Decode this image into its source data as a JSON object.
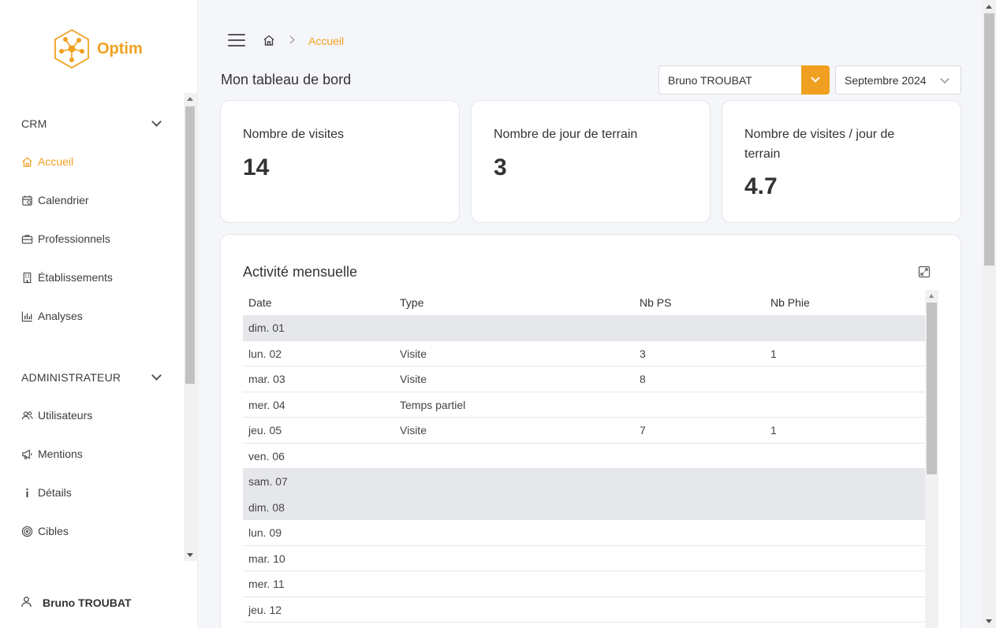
{
  "app": {
    "name": "Optim",
    "accent_color": "#f0a020"
  },
  "sidebar": {
    "sections": [
      {
        "title": "CRM",
        "items": [
          {
            "label": "Accueil",
            "icon": "home-icon",
            "active": true
          },
          {
            "label": "Calendrier",
            "icon": "calendar-icon"
          },
          {
            "label": "Professionnels",
            "icon": "briefcase-icon"
          },
          {
            "label": "Établissements",
            "icon": "building-icon"
          },
          {
            "label": "Analyses",
            "icon": "bar-chart-icon"
          }
        ]
      },
      {
        "title": "ADMINISTRATEUR",
        "items": [
          {
            "label": "Utilisateurs",
            "icon": "users-icon"
          },
          {
            "label": "Mentions",
            "icon": "megaphone-icon"
          },
          {
            "label": "Détails",
            "icon": "info-icon"
          },
          {
            "label": "Cibles",
            "icon": "target-icon"
          }
        ]
      }
    ],
    "user": "Bruno TROUBAT"
  },
  "breadcrumb": {
    "current": "Accueil"
  },
  "page": {
    "title": "Mon tableau de bord"
  },
  "filters": {
    "user": "Bruno TROUBAT",
    "month": "Septembre 2024"
  },
  "kpis": [
    {
      "label": "Nombre de visites",
      "value": "14"
    },
    {
      "label": "Nombre de jour de terrain",
      "value": "3"
    },
    {
      "label": "Nombre de visites / jour de terrain",
      "value": "4.7"
    }
  ],
  "activity": {
    "title": "Activité mensuelle",
    "columns": [
      "Date",
      "Type",
      "Nb PS",
      "Nb Phie"
    ],
    "rows": [
      {
        "date": "dim. 01",
        "type": "",
        "nb_ps": "",
        "nb_phie": "",
        "weekend": true
      },
      {
        "date": "lun. 02",
        "type": "Visite",
        "nb_ps": "3",
        "nb_phie": "1"
      },
      {
        "date": "mar. 03",
        "type": "Visite",
        "nb_ps": "8",
        "nb_phie": ""
      },
      {
        "date": "mer. 04",
        "type": "Temps partiel",
        "nb_ps": "",
        "nb_phie": ""
      },
      {
        "date": "jeu. 05",
        "type": "Visite",
        "nb_ps": "7",
        "nb_phie": "1"
      },
      {
        "date": "ven. 06",
        "type": "",
        "nb_ps": "",
        "nb_phie": ""
      },
      {
        "date": "sam. 07",
        "type": "",
        "nb_ps": "",
        "nb_phie": "",
        "weekend": true
      },
      {
        "date": "dim. 08",
        "type": "",
        "nb_ps": "",
        "nb_phie": "",
        "weekend": true
      },
      {
        "date": "lun. 09",
        "type": "",
        "nb_ps": "",
        "nb_phie": ""
      },
      {
        "date": "mar. 10",
        "type": "",
        "nb_ps": "",
        "nb_phie": ""
      },
      {
        "date": "mer. 11",
        "type": "",
        "nb_ps": "",
        "nb_phie": ""
      },
      {
        "date": "jeu. 12",
        "type": "",
        "nb_ps": "",
        "nb_phie": ""
      }
    ]
  }
}
